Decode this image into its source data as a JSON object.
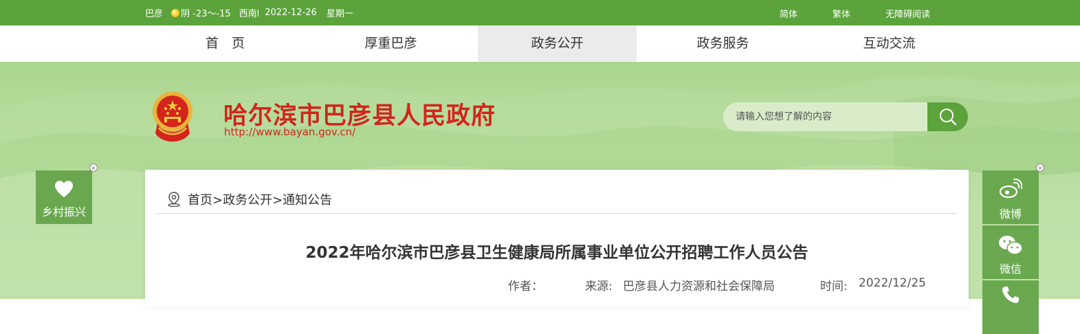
{
  "topbar": {
    "location": "巴彦",
    "weather": "阴 -23～-15",
    "wind": "西南l",
    "date": "2022-12-26",
    "weekday": "星期一",
    "links": [
      "简体",
      "繁体",
      "无障碍阅读"
    ]
  },
  "nav": {
    "items": [
      "首　页",
      "厚重巴彦",
      "政务公开",
      "政务服务",
      "互动交流"
    ],
    "active": "政务公开"
  },
  "header": {
    "title": "哈尔滨市巴彦县人民政府",
    "url": "http://www.bayan.gov.cn/"
  },
  "search": {
    "placeholder": "请输入您想了解的内容",
    "icon": "search-icon"
  },
  "breadcrumb": {
    "text": "首页>政务公开>通知公告",
    "icon": "location-pin-icon"
  },
  "article": {
    "title": "2022年哈尔滨市巴彦县卫生健康局所属事业单位公开招聘工作人员公告",
    "author_label": "作者：",
    "source_label": "来源:",
    "source": "巴彦县人力资源和社会保障局",
    "time_label": "时间:",
    "time": "2022/12/25"
  },
  "float_left": {
    "label": "乡村振兴",
    "icon": "heart-icon"
  },
  "float_right": {
    "items": [
      {
        "label": "微博",
        "icon": "weibo-icon"
      },
      {
        "label": "微信",
        "icon": "wechat-icon"
      },
      {
        "label": "",
        "icon": "phone-icon"
      }
    ]
  },
  "colors": {
    "brand_green": "#5ba33a",
    "widget_green": "#6aa84f",
    "title_red": "#d4241c"
  }
}
